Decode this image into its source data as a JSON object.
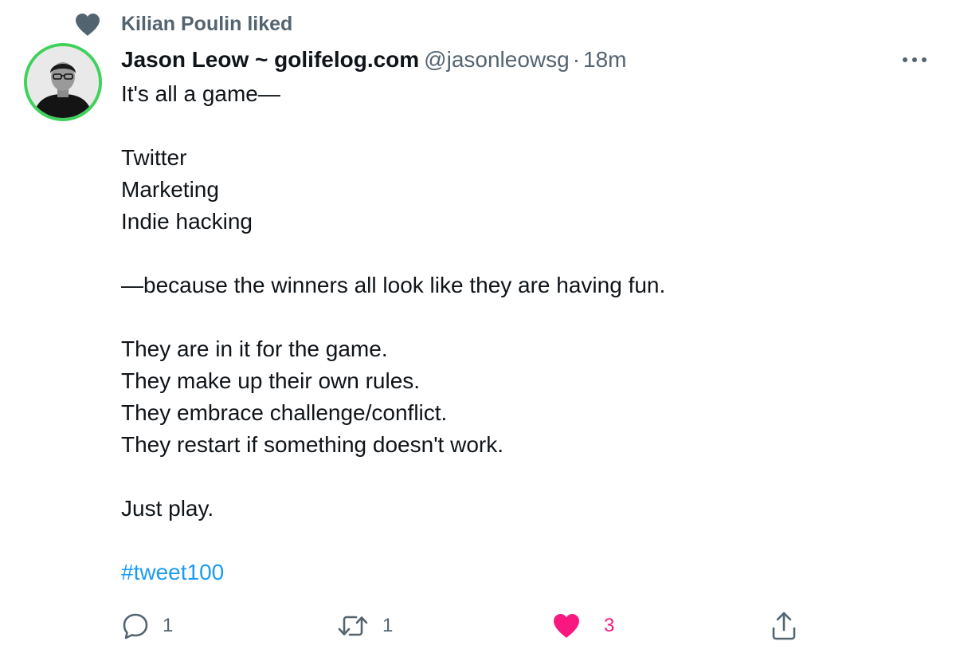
{
  "social_context": {
    "text": "Kilian Poulin liked",
    "icon": "heart-icon"
  },
  "tweet": {
    "author": {
      "display_name": "Jason Leow ~ golifelog.com",
      "handle": "@jasonleowsg",
      "avatar": "avatar"
    },
    "separator": "·",
    "timestamp": "18m",
    "more_icon": "more-icon",
    "body": {
      "intro": "It's all a game—",
      "topics": [
        "Twitter",
        "Marketing",
        "Indie hacking"
      ],
      "reason": "—because the winners all look like they are having fun.",
      "traits": [
        "They are in it for the game.",
        "They make up their own rules.",
        "They embrace challenge/conflict.",
        "They restart if something doesn't work."
      ],
      "closing": "Just play.",
      "hashtag": "#tweet100"
    },
    "actions": {
      "reply": {
        "icon": "reply-icon",
        "count": "1"
      },
      "retweet": {
        "icon": "retweet-icon",
        "count": "1"
      },
      "like": {
        "icon": "heart-filled-icon",
        "count": "3",
        "liked": true
      },
      "share": {
        "icon": "share-icon"
      }
    }
  },
  "colors": {
    "text_primary": "#0f1419",
    "text_secondary": "#536471",
    "link": "#1d9bf0",
    "like": "#f91880",
    "avatar_ring": "#3fd25b"
  }
}
